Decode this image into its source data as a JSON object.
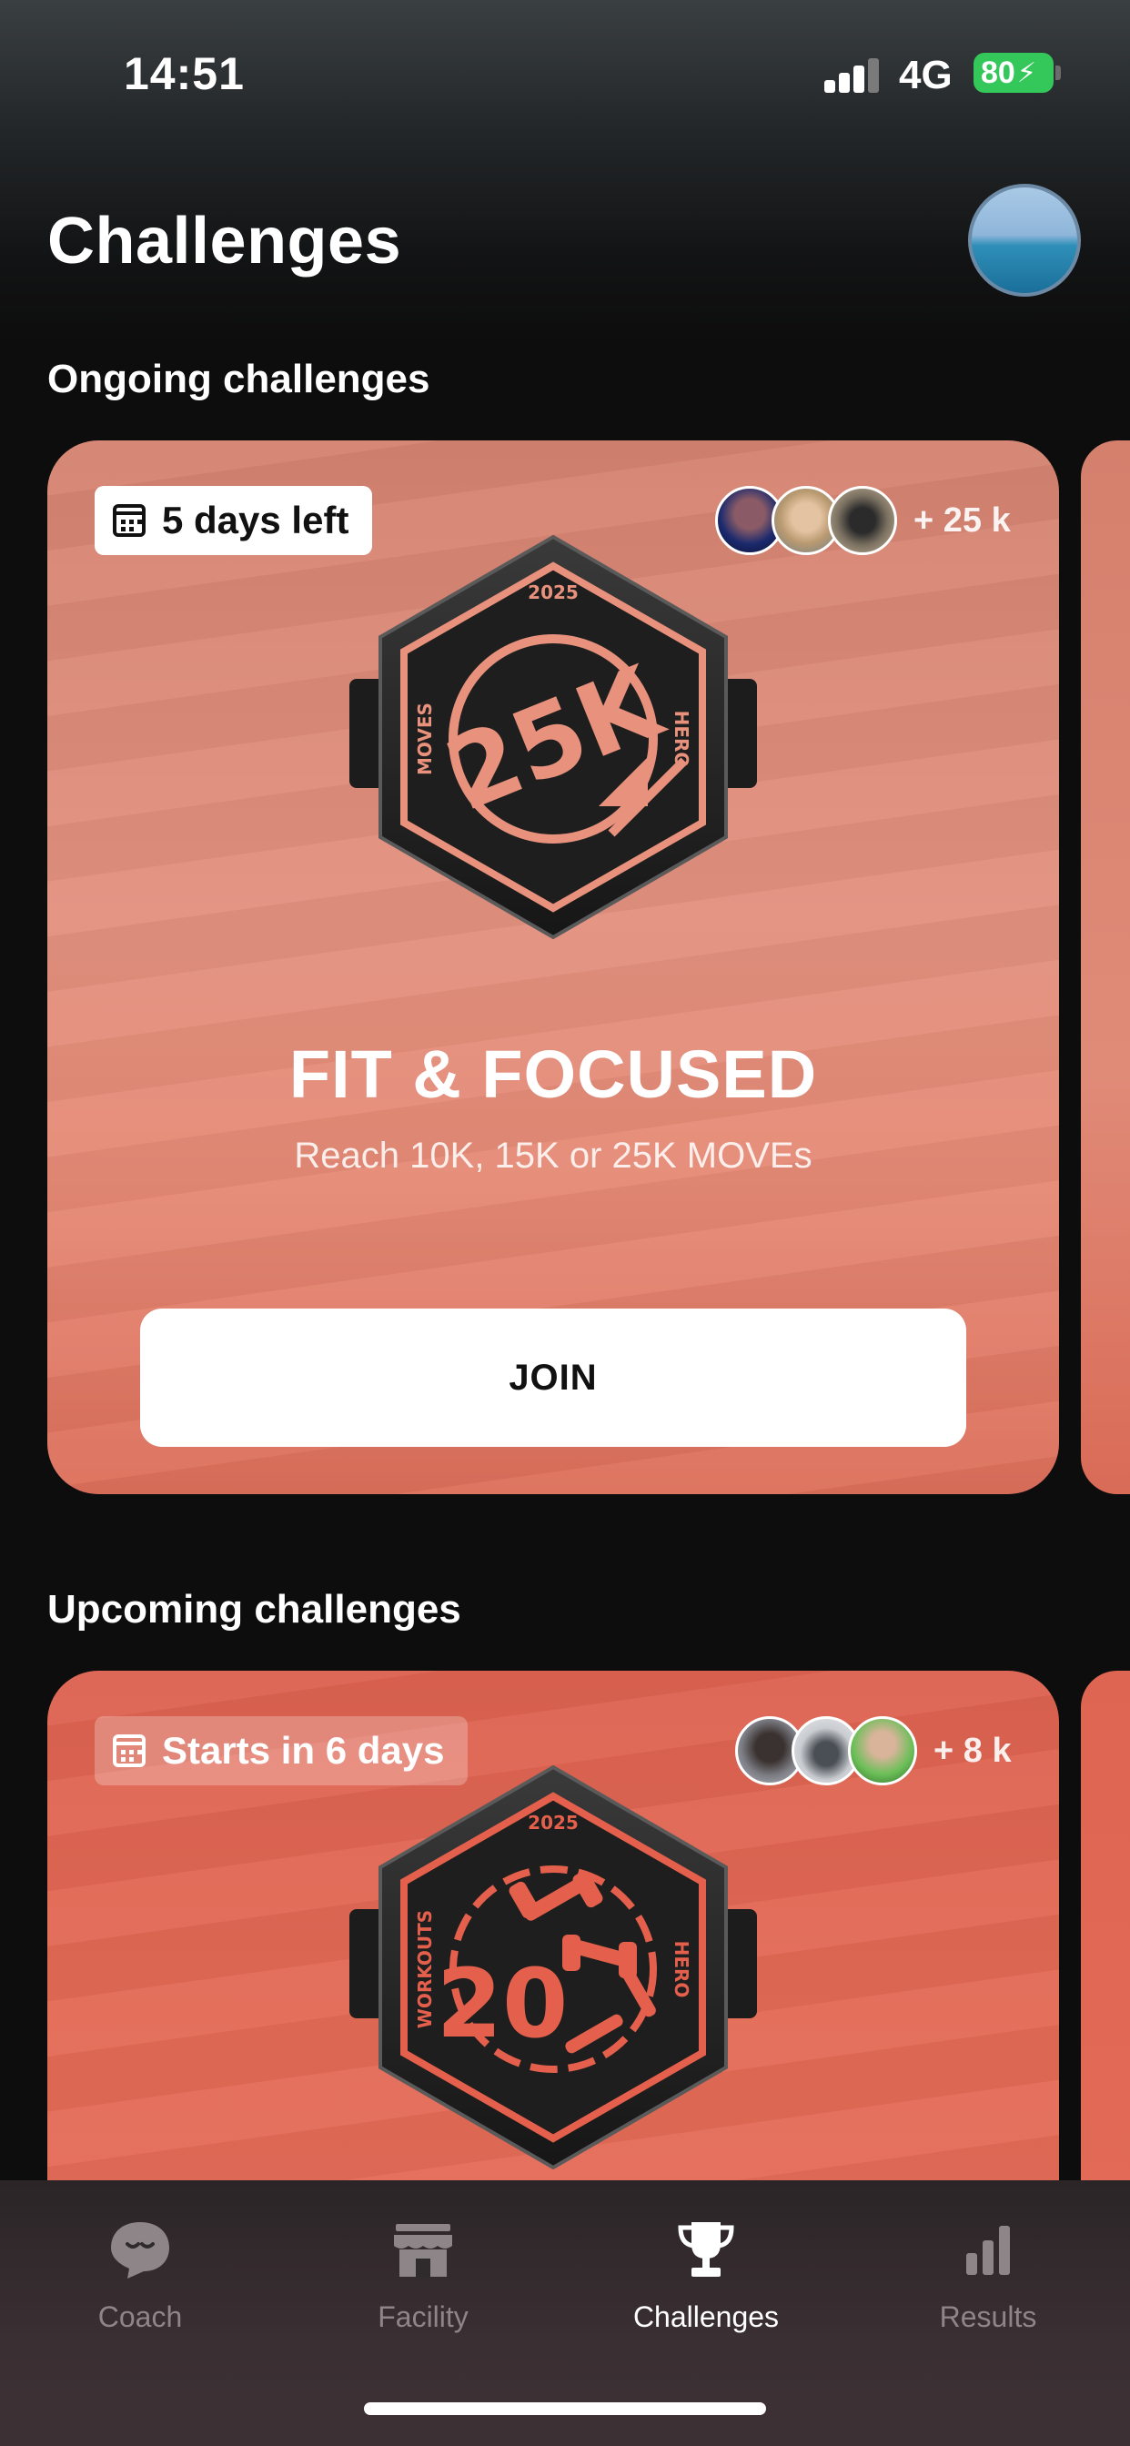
{
  "status_bar": {
    "time": "14:51",
    "network": "4G",
    "battery": "80"
  },
  "header": {
    "title": "Challenges"
  },
  "sections": {
    "ongoing_title": "Ongoing challenges",
    "upcoming_title": "Upcoming challenges"
  },
  "ongoing": {
    "time_label": "5 days left",
    "participants_more": "+ 25 k",
    "badge": {
      "year": "2025",
      "left": "MOVES",
      "right": "HERO",
      "center": "25K"
    },
    "name": "FIT & FOCUSED",
    "description": "Reach 10K, 15K or 25K MOVEs",
    "join_label": "JOIN"
  },
  "upcoming": {
    "time_label": "Starts in 6 days",
    "participants_more": "+ 8 k",
    "badge": {
      "year": "2025",
      "left": "WORKOUTS",
      "right": "HERO",
      "center": "20"
    }
  },
  "tabs": [
    {
      "label": "Coach",
      "icon": "chat-bubble-icon",
      "active": false
    },
    {
      "label": "Facility",
      "icon": "storefront-icon",
      "active": false
    },
    {
      "label": "Challenges",
      "icon": "trophy-icon",
      "active": true
    },
    {
      "label": "Results",
      "icon": "bar-chart-icon",
      "active": false
    }
  ],
  "colors": {
    "badge_accent_ongoing": "#e8917c",
    "badge_accent_upcoming": "#e4604c",
    "battery": "#34c759"
  }
}
